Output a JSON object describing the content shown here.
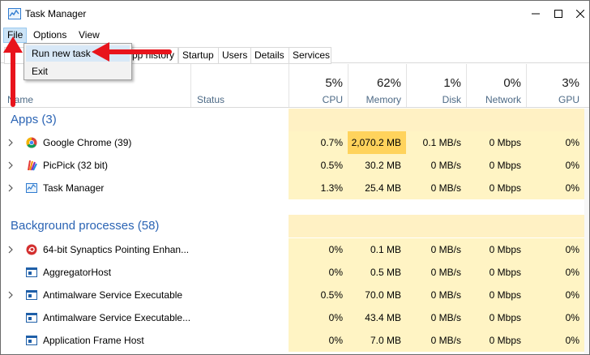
{
  "window": {
    "title": "Task Manager",
    "controls": {
      "minimize": "minimize-icon",
      "maximize": "maximize-icon",
      "close": "close-icon"
    }
  },
  "menubar": {
    "file": "File",
    "options": "Options",
    "view": "View"
  },
  "file_menu": {
    "run_new_task": "Run new task",
    "exit": "Exit"
  },
  "tabs": {
    "app_history_visible": "pp history",
    "startup": "Startup",
    "users": "Users",
    "details": "Details",
    "services": "Services"
  },
  "header": {
    "name": "Name",
    "status": "Status",
    "cpu": {
      "pct": "5%",
      "label": "CPU"
    },
    "memory": {
      "pct": "62%",
      "label": "Memory"
    },
    "disk": {
      "pct": "1%",
      "label": "Disk"
    },
    "network": {
      "pct": "0%",
      "label": "Network"
    },
    "gpu": {
      "pct": "3%",
      "label": "GPU"
    }
  },
  "groups": {
    "apps": "Apps (3)",
    "background": "Background processes (58)"
  },
  "apps": [
    {
      "name": "Google Chrome (39)",
      "icon": "chrome-icon",
      "cpu": "0.7%",
      "memory": "2,070.2 MB",
      "disk": "0.1 MB/s",
      "network": "0 Mbps",
      "gpu": "0%"
    },
    {
      "name": "PicPick (32 bit)",
      "icon": "picpick-icon",
      "cpu": "0.5%",
      "memory": "30.2 MB",
      "disk": "0 MB/s",
      "network": "0 Mbps",
      "gpu": "0%"
    },
    {
      "name": "Task Manager",
      "icon": "task-manager-icon",
      "cpu": "1.3%",
      "memory": "25.4 MB",
      "disk": "0 MB/s",
      "network": "0 Mbps",
      "gpu": "0%"
    }
  ],
  "background": [
    {
      "name": "64-bit Synaptics Pointing Enhan...",
      "icon": "synaptics-icon",
      "cpu": "0%",
      "memory": "0.1 MB",
      "disk": "0 MB/s",
      "network": "0 Mbps",
      "gpu": "0%"
    },
    {
      "name": "AggregatorHost",
      "icon": "service-icon",
      "cpu": "0%",
      "memory": "0.5 MB",
      "disk": "0 MB/s",
      "network": "0 Mbps",
      "gpu": "0%"
    },
    {
      "name": "Antimalware Service Executable",
      "icon": "service-icon",
      "cpu": "0.5%",
      "memory": "70.0 MB",
      "disk": "0 MB/s",
      "network": "0 Mbps",
      "gpu": "0%"
    },
    {
      "name": "Antimalware Service Executable...",
      "icon": "service-icon",
      "cpu": "0%",
      "memory": "43.4 MB",
      "disk": "0 MB/s",
      "network": "0 Mbps",
      "gpu": "0%"
    },
    {
      "name": "Application Frame Host",
      "icon": "service-icon",
      "cpu": "0%",
      "memory": "7.0 MB",
      "disk": "0 MB/s",
      "network": "0 Mbps",
      "gpu": "0%"
    }
  ],
  "colors": {
    "annotation_arrow": "#e8141c",
    "heat_light": "#fff4c4",
    "heat_high": "#ffd35c",
    "group_title": "#2b64b4"
  }
}
